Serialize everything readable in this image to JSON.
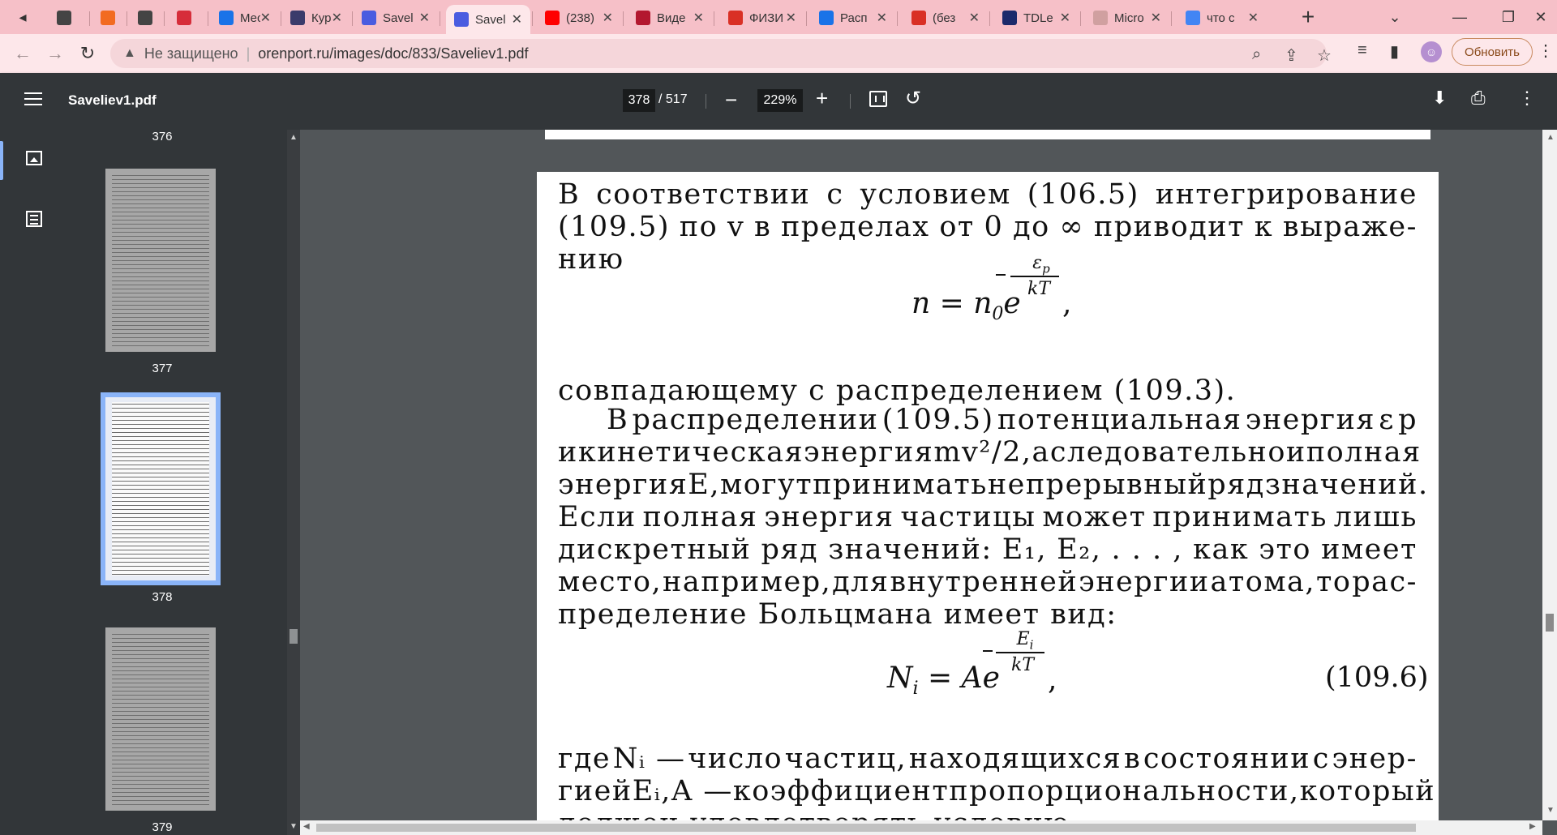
{
  "browser": {
    "tabs": [
      {
        "title": "",
        "icon": "audio-icon",
        "color": "#444444"
      },
      {
        "title": "",
        "icon": "figma-style-icon",
        "color": "#f26b21"
      },
      {
        "title": "",
        "icon": "book-icon",
        "color": "#444444"
      },
      {
        "title": "",
        "icon": "brand-icon",
        "color": "#d62d3a"
      },
      {
        "title": "Месс",
        "icon": "messenger-icon",
        "color": "#1a73e8"
      },
      {
        "title": "Курс",
        "icon": "graduation-icon",
        "color": "#3b3b6b"
      },
      {
        "title": "Savel",
        "icon": "pdf-ring-icon",
        "color": "#4a5ce0"
      },
      {
        "title": "Savel",
        "icon": "pdf-ring-icon",
        "color": "#4a5ce0"
      },
      {
        "title": "(238)",
        "icon": "youtube-icon",
        "color": "#ff0000"
      },
      {
        "title": "Виде",
        "icon": "video-icon",
        "color": "#b3182f"
      },
      {
        "title": "ФИЗИ",
        "icon": "gmail-icon",
        "color": "#d93025"
      },
      {
        "title": "Расп",
        "icon": "s-icon",
        "color": "#1a73e8"
      },
      {
        "title": "(без",
        "icon": "gmail-icon",
        "color": "#d93025"
      },
      {
        "title": "TDLe",
        "icon": "tdle-icon",
        "color": "#1b2a6b"
      },
      {
        "title": "Micro",
        "icon": "microsoft-icon",
        "color": "#d0a0a0"
      },
      {
        "title": "что с",
        "icon": "google-icon",
        "color": "#4285f4"
      }
    ],
    "active_tab_index": 7,
    "not_secure_label": "Не защищено",
    "url": "orenport.ru/images/doc/833/Saveliev1.pdf",
    "update_button": "Обновить"
  },
  "pdf_toolbar": {
    "doc_title": "Saveliev1.pdf",
    "current_page": "378",
    "total_pages": "/ 517",
    "zoom": "229%"
  },
  "sidebar": {
    "labels": [
      "376",
      "377",
      "378",
      "379"
    ],
    "selected": "378"
  },
  "page_text": {
    "line1": [
      "В",
      "соответствии",
      "с",
      "условием",
      "(106.5)",
      "интегрирование"
    ],
    "line2": [
      "(109.5)",
      "по",
      "v",
      "в",
      "пределах",
      "от",
      "0",
      "до",
      "∞",
      "приводит",
      "к",
      "выраже-"
    ],
    "line3": "нию",
    "formula1": {
      "lhs": "n = n",
      "sub": "0",
      "e": "e",
      "num": "ε",
      "num_sub": "p",
      "den": "kT",
      "comma": ","
    },
    "line4": "совпадающему с распределением (109.3).",
    "line5": [
      "В",
      "распределении",
      "(109.5)",
      "потенциальная",
      "энергия",
      "ε",
      "p"
    ],
    "line6": [
      "и",
      "кинетическая",
      "энергия",
      "mv²/2,",
      "а",
      "следовательно",
      "и",
      "полная"
    ],
    "line7": [
      "энергия",
      "E,",
      "могут",
      "принимать",
      "непрерывный",
      "ряд",
      "значений."
    ],
    "line8": [
      "Если",
      "полная",
      "энергия",
      "частицы",
      "может",
      "принимать",
      "лишь"
    ],
    "line9": [
      "дискретный",
      "ряд",
      "значений:",
      "E₁,",
      "E₂,",
      ". . . ,",
      "как",
      "это",
      "имеет"
    ],
    "line10": [
      "место,",
      "например,",
      "для",
      "внутренней",
      "энергии",
      "атома,",
      "то",
      "рас-"
    ],
    "line11": "пределение Больцмана имеет вид:",
    "formula2": {
      "lhs": "N",
      "sub": "i",
      "mid": " = Ae",
      "num": "E",
      "num_sub": "i",
      "den": "kT",
      "comma": ",",
      "eqnum": "(109.6)"
    },
    "line12": [
      "где",
      "Nᵢ —",
      "число",
      "частиц,",
      "находящихся",
      "в",
      "состоянии",
      "с",
      "энер-"
    ],
    "line13": [
      "гией",
      "Eᵢ,",
      "A —",
      "коэффициент",
      "пропорциональности,",
      "который"
    ],
    "line14": "должен удовлетворять условию"
  }
}
